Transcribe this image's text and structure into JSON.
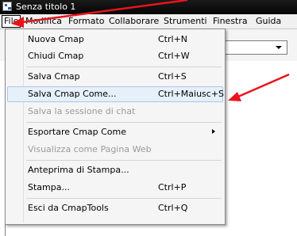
{
  "window": {
    "title": "Senza titolo 1"
  },
  "menubar": {
    "items": [
      "File",
      "Modifica",
      "Formato",
      "Collaborare",
      "Strumenti",
      "Finestra",
      "Guida"
    ],
    "open_index": 0
  },
  "file_menu": {
    "items": [
      {
        "label": "Nuova Cmap",
        "shortcut": "Ctrl+N"
      },
      {
        "label": "Chiudi Cmap",
        "shortcut": "Ctrl+W"
      },
      {
        "label": "Salva Cmap",
        "shortcut": "Ctrl+S"
      },
      {
        "label": "Salva Cmap Come...",
        "shortcut": "Ctrl+Maiusc+S",
        "highlighted": true
      },
      {
        "label": "Salva la sessione di chat",
        "disabled": true
      },
      {
        "label": "Esportare Cmap Come",
        "submenu": true
      },
      {
        "label": "Visualizza come Pagina Web",
        "disabled": true
      },
      {
        "label": "Anteprima di Stampa..."
      },
      {
        "label": "Stampa...",
        "shortcut": "Ctrl+P"
      },
      {
        "label": "Esci da CmapTools",
        "shortcut": "Ctrl+Q"
      }
    ]
  },
  "annotations": {
    "arrow_color": "#e8141b"
  }
}
